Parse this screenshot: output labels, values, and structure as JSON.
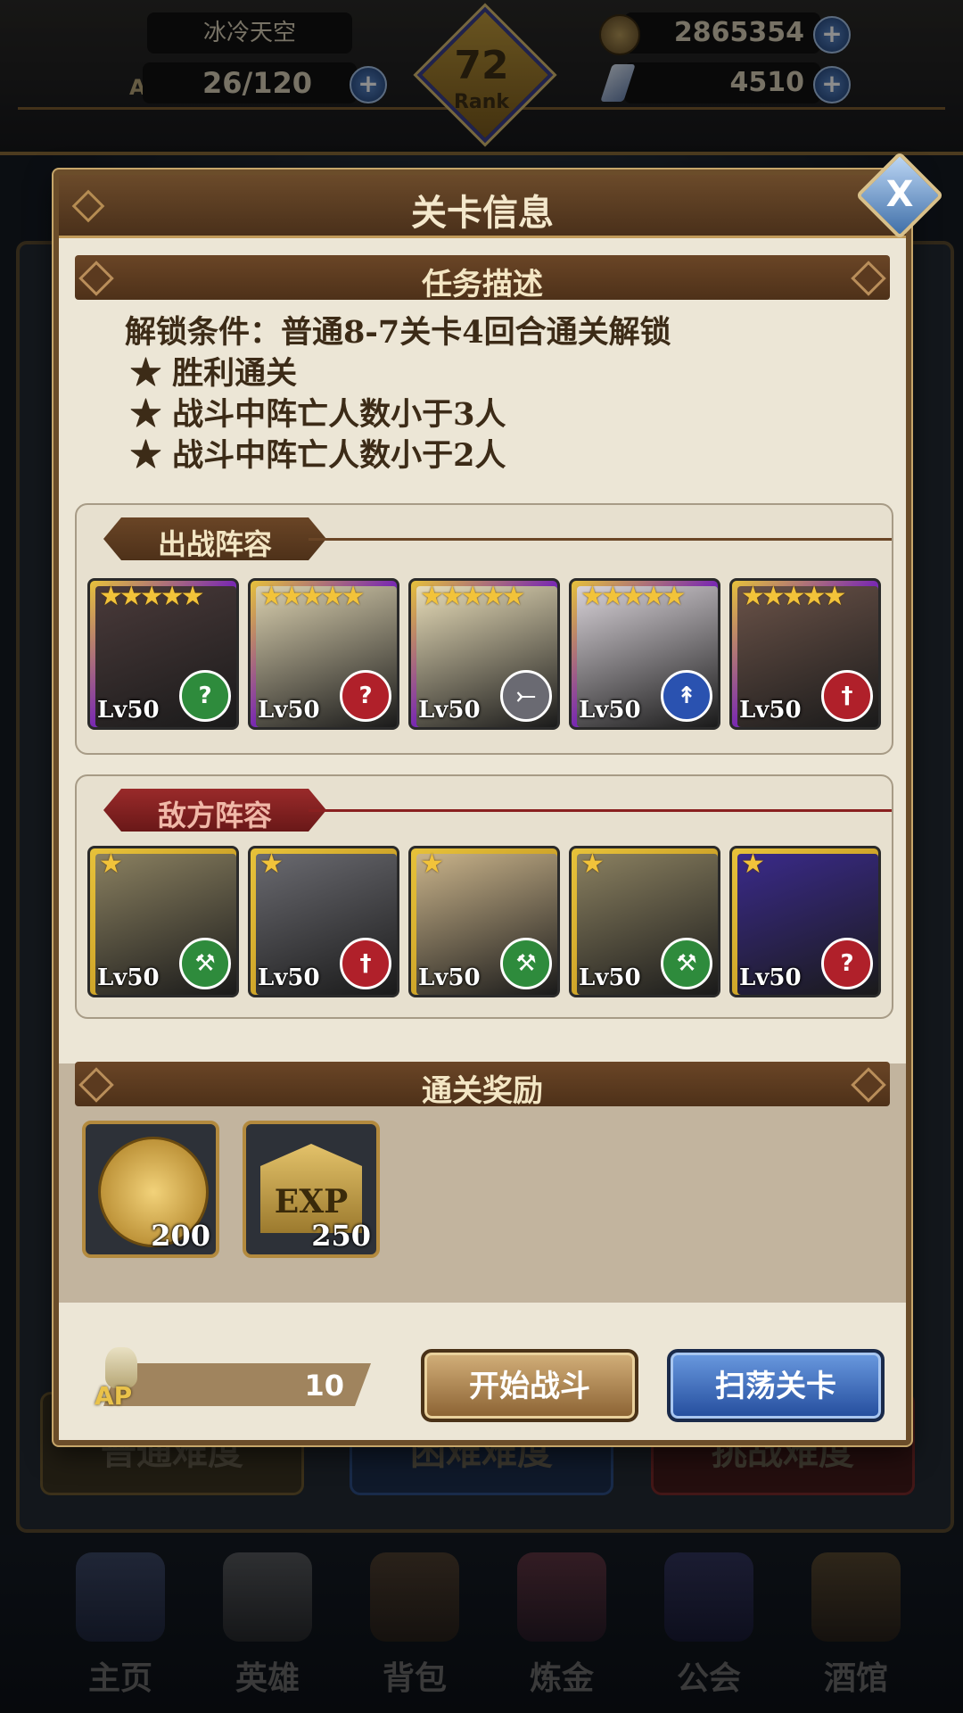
{
  "topbar": {
    "player_name": "冰冷天空",
    "ap_label": "AP",
    "ap_value": "26/120",
    "rank_number": "72",
    "rank_label": "Rank",
    "gold": "2865354",
    "gems": "4510",
    "plus_symbol": "+"
  },
  "background": {
    "difficulty_buttons": [
      "普通难度",
      "困难难度",
      "挑战难度"
    ]
  },
  "bottom_nav": [
    {
      "label": "主页",
      "icon": "castle-icon"
    },
    {
      "label": "英雄",
      "icon": "helmet-icon"
    },
    {
      "label": "背包",
      "icon": "backpack-icon"
    },
    {
      "label": "炼金",
      "icon": "flask-icon"
    },
    {
      "label": "公会",
      "icon": "shield-icon"
    },
    {
      "label": "酒馆",
      "icon": "tavern-icon"
    }
  ],
  "dialog": {
    "title": "关卡信息",
    "close_icon": "close-icon",
    "close_symbol": "X",
    "mission": {
      "header": "任务描述",
      "unlock": "解锁条件：普通8-7关卡4回合通关解锁",
      "goals": [
        "★ 胜利通关",
        "★ 战斗中阵亡人数小于3人",
        "★ 战斗中阵亡人数小于2人"
      ]
    },
    "own_team": {
      "header": "出战阵容",
      "heroes": [
        {
          "level": "Lv50",
          "stars": "★★★★★",
          "class_icon": "staff-icon",
          "class_color": "#2e8b3c",
          "portrait": "#4a3a3a"
        },
        {
          "level": "Lv50",
          "stars": "★★★★★",
          "class_icon": "staff-icon",
          "class_color": "#b0202a",
          "portrait": "#d9cfae"
        },
        {
          "level": "Lv50",
          "stars": "★★★★★",
          "class_icon": "bow-icon",
          "class_color": "#6a6a72",
          "portrait": "#e7dcb8"
        },
        {
          "level": "Lv50",
          "stars": "★★★★★",
          "class_icon": "spear-icon",
          "class_color": "#2a52b0",
          "portrait": "#d8d2d8"
        },
        {
          "level": "Lv50",
          "stars": "★★★★★",
          "class_icon": "sword-icon",
          "class_color": "#b0202a",
          "portrait": "#6a5248"
        }
      ]
    },
    "enemy_team": {
      "header": "敌方阵容",
      "heroes": [
        {
          "level": "Lv50",
          "stars": "★",
          "class_icon": "axe-icon",
          "class_color": "#2e8b3c",
          "portrait": "#8a8060"
        },
        {
          "level": "Lv50",
          "stars": "★",
          "class_icon": "sword-icon",
          "class_color": "#b0202a",
          "portrait": "#6a6a70"
        },
        {
          "level": "Lv50",
          "stars": "★",
          "class_icon": "axe-icon",
          "class_color": "#2e8b3c",
          "portrait": "#c9b38a"
        },
        {
          "level": "Lv50",
          "stars": "★",
          "class_icon": "axe-icon",
          "class_color": "#2e8b3c",
          "portrait": "#8a8060"
        },
        {
          "level": "Lv50",
          "stars": "★",
          "class_icon": "staff-icon",
          "class_color": "#b0202a",
          "portrait": "#3a2a8a"
        }
      ]
    },
    "rewards": {
      "header": "通关奖励",
      "items": [
        {
          "name": "gold-coin-icon",
          "amount": "200"
        },
        {
          "name": "exp-badge-icon",
          "text": "EXP",
          "amount": "250"
        }
      ]
    },
    "ap_cost": {
      "label": "AP",
      "value": "10"
    },
    "buttons": {
      "fight": "开始战斗",
      "sweep": "扫荡关卡"
    }
  }
}
